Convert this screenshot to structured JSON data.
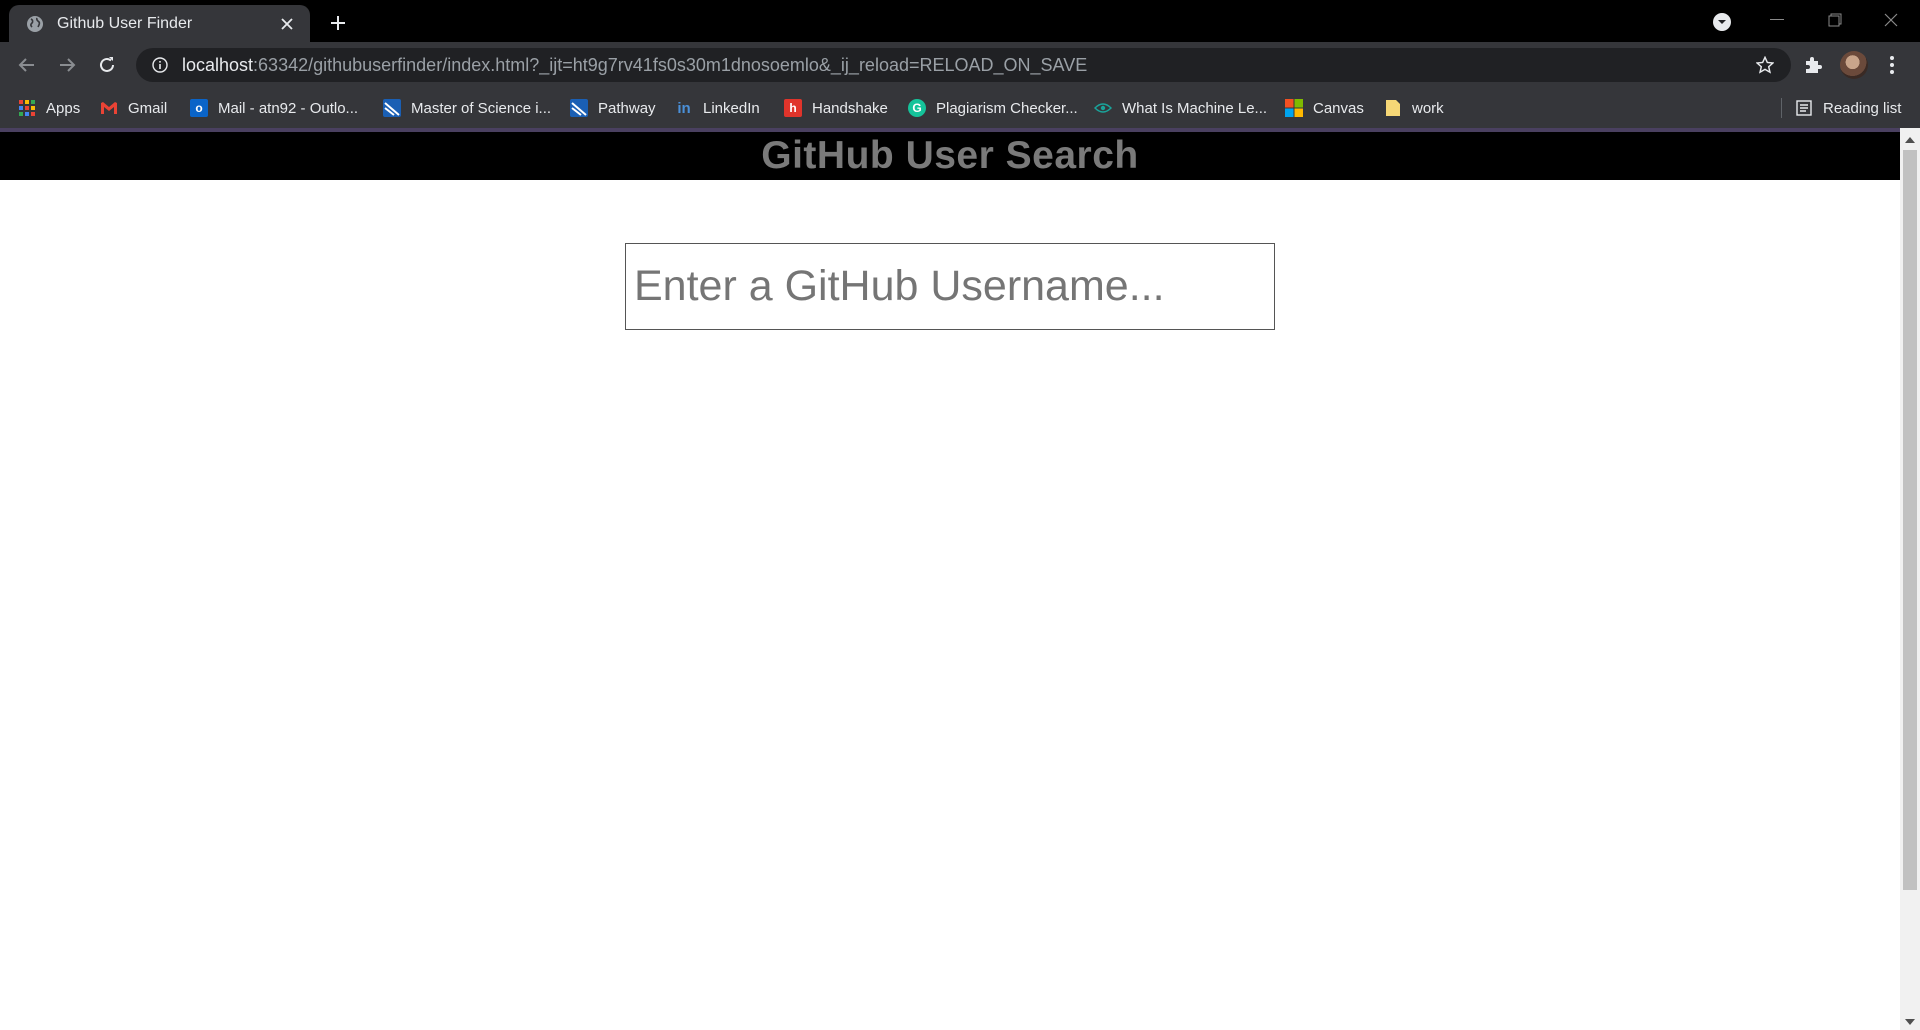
{
  "browser": {
    "tab": {
      "title": "Github User Finder",
      "favicon": "globe-icon"
    },
    "address": {
      "host": "localhost",
      "rest": ":63342/githubuserfinder/index.html?_ijt=ht9g7rv41fs0s30m1dnosoemlo&_ij_reload=RELOAD_ON_SAVE"
    },
    "bookmarks": [
      {
        "label": "Apps",
        "icon": "apps-grid-icon"
      },
      {
        "label": "Gmail",
        "icon": "gmail-icon"
      },
      {
        "label": "Mail - atn92 - Outlo...",
        "icon": "outlook-icon"
      },
      {
        "label": "Master of Science i...",
        "icon": "university-icon"
      },
      {
        "label": "Pathway",
        "icon": "university-icon"
      },
      {
        "label": "LinkedIn",
        "icon": "linkedin-icon"
      },
      {
        "label": "Handshake",
        "icon": "handshake-icon"
      },
      {
        "label": "Plagiarism Checker...",
        "icon": "grammarly-icon"
      },
      {
        "label": "What Is Machine Le...",
        "icon": "eye-icon"
      },
      {
        "label": "Canvas",
        "icon": "microsoft-icon"
      },
      {
        "label": "work",
        "icon": "folder-icon"
      }
    ],
    "reading_list": "Reading list"
  },
  "page": {
    "header_title": "GitHub User Search",
    "search": {
      "placeholder": "Enter a GitHub Username...",
      "value": ""
    }
  },
  "colors": {
    "chrome_dark": "#35363a",
    "tabstrip": "#000000",
    "header_bg": "#000000",
    "header_text": "#7a7a7a"
  }
}
